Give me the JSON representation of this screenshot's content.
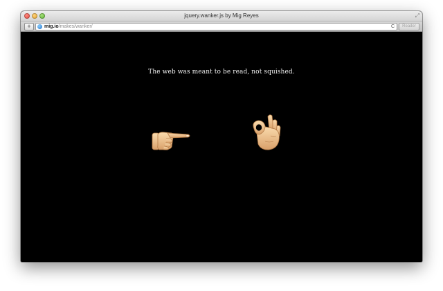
{
  "window": {
    "title": "jquery.wanker.js by Mig Reyes"
  },
  "toolbar": {
    "add_label": "+",
    "url_host": "mig.io",
    "url_path": "/makes/wanker/",
    "reload_glyph": "C",
    "reader_label": "Reader"
  },
  "content": {
    "message": "The web was meant to be read, not squished.",
    "icons": [
      "pointing-hand-icon",
      "ok-hand-icon"
    ],
    "skin_color": "#f3c58d",
    "background": "#000000"
  }
}
